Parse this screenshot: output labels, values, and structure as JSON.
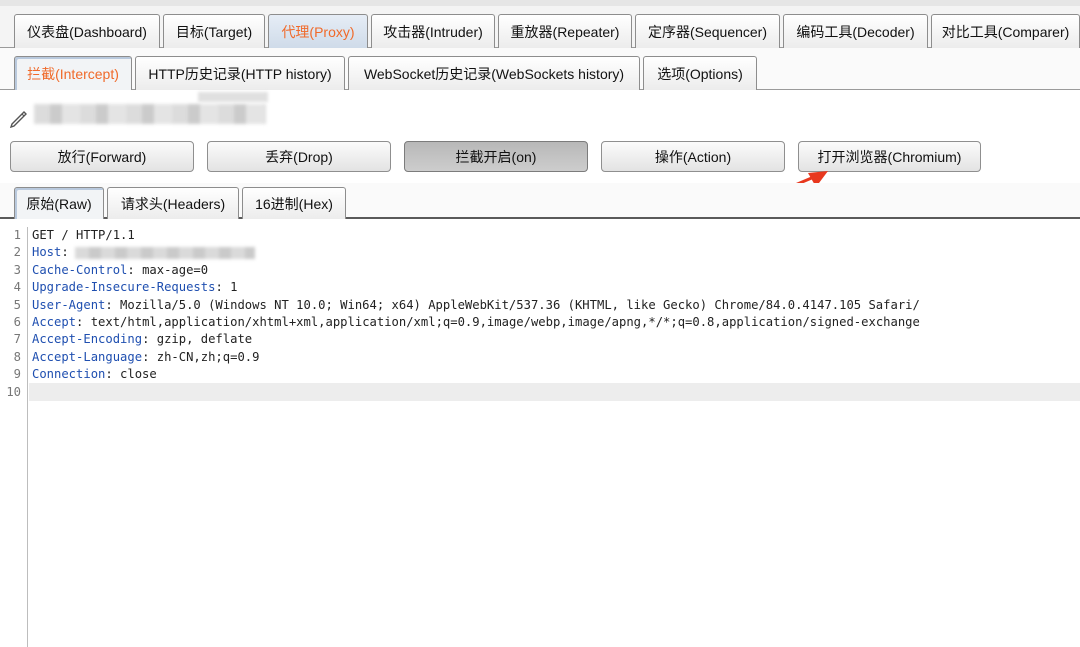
{
  "main_tabs": [
    {
      "label": "仪表盘(Dashboard)",
      "active": false
    },
    {
      "label": "目标(Target)",
      "active": false
    },
    {
      "label": "代理(Proxy)",
      "active": true
    },
    {
      "label": "攻击器(Intruder)",
      "active": false
    },
    {
      "label": "重放器(Repeater)",
      "active": false
    },
    {
      "label": "定序器(Sequencer)",
      "active": false
    },
    {
      "label": "编码工具(Decoder)",
      "active": false
    },
    {
      "label": "对比工具(Comparer)",
      "active": false
    }
  ],
  "proxy_tabs": [
    {
      "label": "拦截(Intercept)",
      "active": true
    },
    {
      "label": "HTTP历史记录(HTTP history)",
      "active": false
    },
    {
      "label": "WebSocket历史记录(WebSockets history)",
      "active": false
    },
    {
      "label": "选项(Options)",
      "active": false
    }
  ],
  "actions": {
    "forward": "放行(Forward)",
    "drop": "丢弃(Drop)",
    "intercept_toggle": "拦截开启(on)",
    "action": "操作(Action)",
    "open_browser": "打开浏览器(Chromium)"
  },
  "view_tabs": [
    {
      "label": "原始(Raw)",
      "active": true
    },
    {
      "label": "请求头(Headers)",
      "active": false
    },
    {
      "label": "16进制(Hex)",
      "active": false
    }
  ],
  "request_lines": [
    {
      "num": "1",
      "key": "",
      "rest": "GET / HTTP/1.1"
    },
    {
      "num": "2",
      "key": "Host",
      "rest": ":"
    },
    {
      "num": "3",
      "key": "Cache-Control",
      "rest": ": max-age=0"
    },
    {
      "num": "4",
      "key": "Upgrade-Insecure-Requests",
      "rest": ": 1"
    },
    {
      "num": "5",
      "key": "User-Agent",
      "rest": ": Mozilla/5.0 (Windows NT 10.0; Win64; x64) AppleWebKit/537.36 (KHTML, like Gecko) Chrome/84.0.4147.105 Safari/"
    },
    {
      "num": "6",
      "key": "Accept",
      "rest": ": text/html,application/xhtml+xml,application/xml;q=0.9,image/webp,image/apng,*/*;q=0.8,application/signed-exchange"
    },
    {
      "num": "7",
      "key": "Accept-Encoding",
      "rest": ": gzip, deflate"
    },
    {
      "num": "8",
      "key": "Accept-Language",
      "rest": ": zh-CN,zh;q=0.9"
    },
    {
      "num": "9",
      "key": "Connection",
      "rest": ": close"
    },
    {
      "num": "10",
      "key": "",
      "rest": ""
    }
  ],
  "colors": {
    "active_tab_text": "#f06a2a",
    "header_key": "#1f4fb0",
    "annotation_arrow": "#e8381e"
  }
}
